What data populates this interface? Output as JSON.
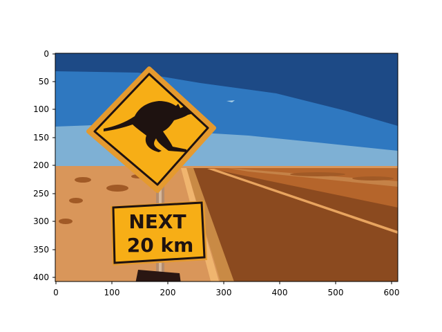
{
  "image": {
    "description_free": true,
    "palette": {
      "sky_dark": "#1d4a86",
      "sky_mid": "#2f78c0",
      "sky_light": "#7eb0d4",
      "ground_sand": "#d9965a",
      "ground_red": "#b5652b",
      "road": "#8b4a1f",
      "road_edge": "#f0b56f",
      "sign_yellow": "#f7ae16",
      "sign_dark": "#1e1210"
    },
    "sign_upper_icon": "kangaroo-icon",
    "sign_lower_line1": "NEXT",
    "sign_lower_line2": "20 km"
  },
  "axes": {
    "x_ticks": [
      "0",
      "100",
      "200",
      "300",
      "400",
      "500",
      "600"
    ],
    "y_ticks": [
      "0",
      "50",
      "100",
      "150",
      "200",
      "250",
      "300",
      "350",
      "400"
    ]
  }
}
